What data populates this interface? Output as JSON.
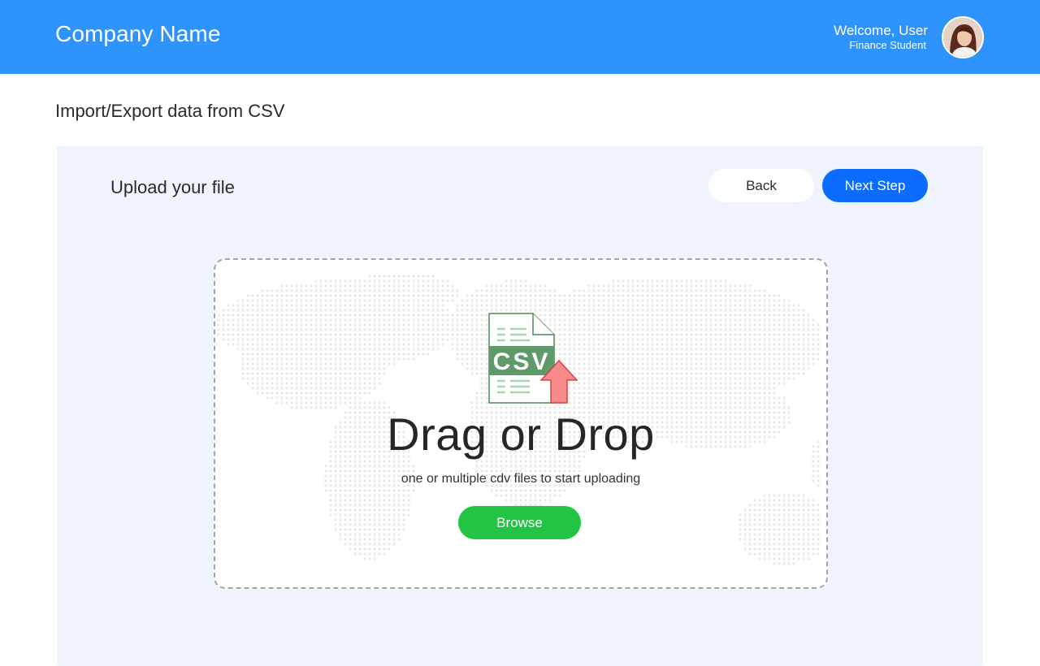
{
  "header": {
    "brand": "Company Name",
    "welcome": "Welcome, User",
    "role": "Finance Student",
    "color": "#2e93fb"
  },
  "page": {
    "title": "Import/Export data from CSV"
  },
  "panel": {
    "title": "Upload your file",
    "back_label": "Back",
    "next_label": "Next Step",
    "next_color": "#0b6cff"
  },
  "dropzone": {
    "file_badge": "CSV",
    "title": "Drag or Drop",
    "subtitle": "one or multiple cdv files to start uploading",
    "browse_label": "Browse",
    "browse_color": "#22c444",
    "icons": [
      "csv-file-icon",
      "upload-arrow-icon",
      "world-map"
    ]
  }
}
